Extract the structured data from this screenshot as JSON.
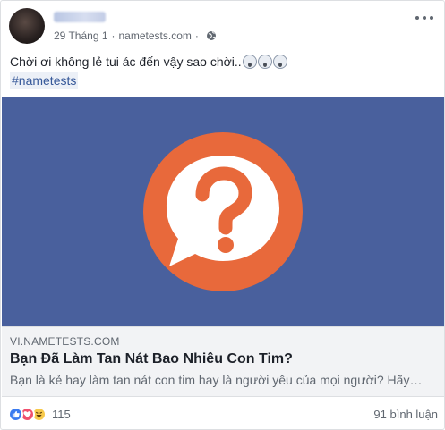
{
  "post": {
    "date": "29 Tháng 1",
    "separator": "·",
    "source": "nametests.com",
    "message": "Chời ơi không lẻ tui ác đến vậy sao chời..",
    "message_emojis": [
      "scream-emoji",
      "scream-emoji",
      "scream-emoji"
    ],
    "hashtag": "#nametests"
  },
  "link": {
    "domain": "VI.NAMETESTS.COM",
    "title": "Bạn Đã Làm Tan Nát Bao Nhiêu Con Tim?",
    "description": "Bạn là kẻ hay làm tan nát con tim hay là người yêu của mọi người? Hãy…",
    "image_icon": "question-mark-speech-bubble-icon",
    "image_bg_color": "#49609d",
    "icon_color": "#e8693b"
  },
  "footer": {
    "reaction_count": "115",
    "reaction_icons": [
      "like-icon",
      "love-icon",
      "haha-icon"
    ],
    "comments": "91 bình luận"
  }
}
